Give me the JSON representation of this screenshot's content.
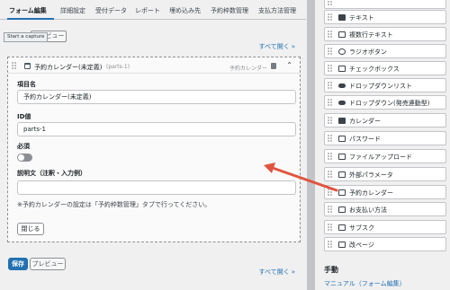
{
  "tabs": [
    "フォーム編集",
    "詳細設定",
    "受付データ",
    "レポート",
    "埋め込み先",
    "予約枠数管理",
    "支払方法管理"
  ],
  "toolbar": {
    "tooltip": "Start a capture",
    "preview_label": "プレビュー",
    "expand_all_label": "すべて開く"
  },
  "field_card": {
    "title": "予約カレンダー(未定義)",
    "id_hint": "(parts-1)",
    "type_label": "予約カレンダー",
    "item_name_label": "項目名",
    "item_name_value": "予約カレンダー(未定義)",
    "id_label": "ID値",
    "id_value": "parts-1",
    "required_label": "必須",
    "required_on": false,
    "description_label": "説明文（注釈・入力例）",
    "description_value": "",
    "note": "※予約カレンダーの設定は「予約枠数管理」タブで行ってください。",
    "close_label": "閉じる"
  },
  "footer": {
    "save_label": "保存",
    "preview_label": "プレビュー",
    "expand_all_label": "すべて開く"
  },
  "palette": {
    "items": [
      {
        "label": "テキスト",
        "icon": "text-icon"
      },
      {
        "label": "複数行テキスト",
        "icon": "textarea-icon"
      },
      {
        "label": "ラジオボタン",
        "icon": "radio-icon"
      },
      {
        "label": "チェックボックス",
        "icon": "checkbox-icon"
      },
      {
        "label": "ドロップダウンリスト",
        "icon": "dropdown-icon"
      },
      {
        "label": "ドロップダウン(発売連動型)",
        "icon": "dropdown-icon"
      },
      {
        "label": "カレンダー",
        "icon": "calendar-icon"
      },
      {
        "label": "パスワード",
        "icon": "password-icon"
      },
      {
        "label": "ファイルアップロード",
        "icon": "file-icon"
      },
      {
        "label": "外部パラメータ",
        "icon": "parameter-icon"
      },
      {
        "label": "予約カレンダー",
        "icon": "calendar-icon"
      },
      {
        "label": "お支払い方法",
        "icon": "payment-icon"
      },
      {
        "label": "サブスク",
        "icon": "subscription-icon"
      },
      {
        "label": "改ページ",
        "icon": "page-break-icon"
      }
    ],
    "section_title": "手動",
    "manual_link": "マニュアル（フォーム編集）"
  },
  "colors": {
    "accent": "#2271b1",
    "arrow": "#e0553f"
  }
}
